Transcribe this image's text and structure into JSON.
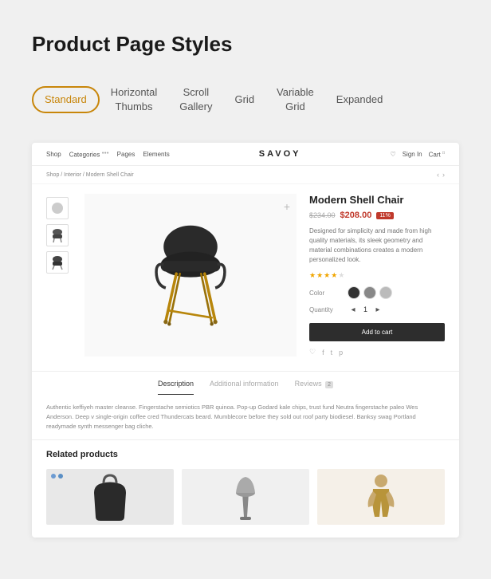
{
  "page": {
    "title": "Product Page Styles"
  },
  "tabs": [
    {
      "id": "standard",
      "label": "Standard",
      "active": true
    },
    {
      "id": "horizontal-thumbs",
      "label": "Horizontal\nThumbs",
      "active": false
    },
    {
      "id": "scroll-gallery",
      "label": "Scroll\nGallery",
      "active": false
    },
    {
      "id": "grid",
      "label": "Grid",
      "active": false
    },
    {
      "id": "variable-grid",
      "label": "Variable\nGrid",
      "active": false
    },
    {
      "id": "expanded",
      "label": "Expanded",
      "active": false
    }
  ],
  "store": {
    "nav_items": [
      "Shop",
      "Categories",
      "Pages",
      "Elements"
    ],
    "logo": "SAVOY",
    "nav_right": [
      "Sign In",
      "Cart"
    ]
  },
  "breadcrumb": "Shop / Interior / Modern Shell Chair",
  "product": {
    "name": "Modern Shell Chair",
    "price_old": "$234.00",
    "price_new": "$208.00",
    "discount": "11%",
    "description": "Designed for simplicity and made from high quality materials, its sleek geometry and material combinations creates a modern personalized look.",
    "stars": 4,
    "color_label": "Color",
    "quantity_label": "Quantity",
    "quantity": "1",
    "add_to_cart": "Add to cart"
  },
  "desc_tabs": [
    {
      "label": "Description",
      "active": true
    },
    {
      "label": "Additional information",
      "active": false
    },
    {
      "label": "Reviews",
      "badge": "2",
      "active": false
    }
  ],
  "desc_text": "Authentic keffiyeh master cleanse. Fingerstache semiotics PBR quinoa. Pop-up Godard kale chips, trust fund Neutra fingerstache paleo Wes Anderson. Deep v single-origin coffee cred Thundercats beard. Mumblecore before they sold out roof party biodiesel. Banksy swag Portland readymade synth messenger bag cliche.",
  "related": {
    "title": "Related products",
    "items": [
      {
        "color1": "#6c9bd2",
        "color2": "#5a8fc5"
      },
      {
        "color1": "#888",
        "color2": "#999"
      },
      {
        "color1": "#c8a96e",
        "color2": "#b89858"
      }
    ]
  },
  "icons": {
    "plus": "+",
    "heart": "♡",
    "facebook": "f",
    "twitter": "t",
    "pinterest": "p",
    "arrow_left": "◂",
    "arrow_right": "▸",
    "chevron_left": "‹",
    "chevron_right": "›"
  }
}
